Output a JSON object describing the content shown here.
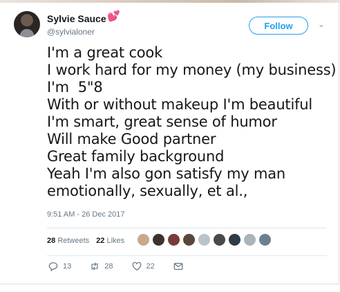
{
  "tweet": {
    "display_name": "Sylvie Sauce",
    "heart_emoji": "💕",
    "handle": "@sylvialoner",
    "follow_label": "Follow",
    "lines": [
      "I'm a great cook",
      "I work hard for my money (my business)",
      "I'm  5\"8",
      "With or without makeup I'm beautiful",
      "I'm smart, great sense of humor",
      "Will make Good partner",
      "Great family background",
      "Yeah I'm also gon satisfy my man",
      "emotionally, sexually, et al.,"
    ],
    "timestamp": "9:51 AM - 26 Dec 2017"
  },
  "stats": {
    "retweets_count": "28",
    "retweets_label": "Retweets",
    "likes_count": "22",
    "likes_label": "Likes"
  },
  "likers": [
    {
      "color": "#c9a98c"
    },
    {
      "color": "#3a3330"
    },
    {
      "color": "#7a3b3b"
    },
    {
      "color": "#5b463c"
    },
    {
      "color": "#b9c3ca"
    },
    {
      "color": "#4a4a4a"
    },
    {
      "color": "#2f3a45"
    },
    {
      "color": "#a9b4bd"
    },
    {
      "color": "#6d7f8e"
    }
  ],
  "actions": {
    "reply_count": "13",
    "retweet_count": "28",
    "like_count": "22"
  },
  "colors": {
    "accent": "#1da1f2",
    "heart": "#e0287b",
    "muted": "#657786"
  }
}
